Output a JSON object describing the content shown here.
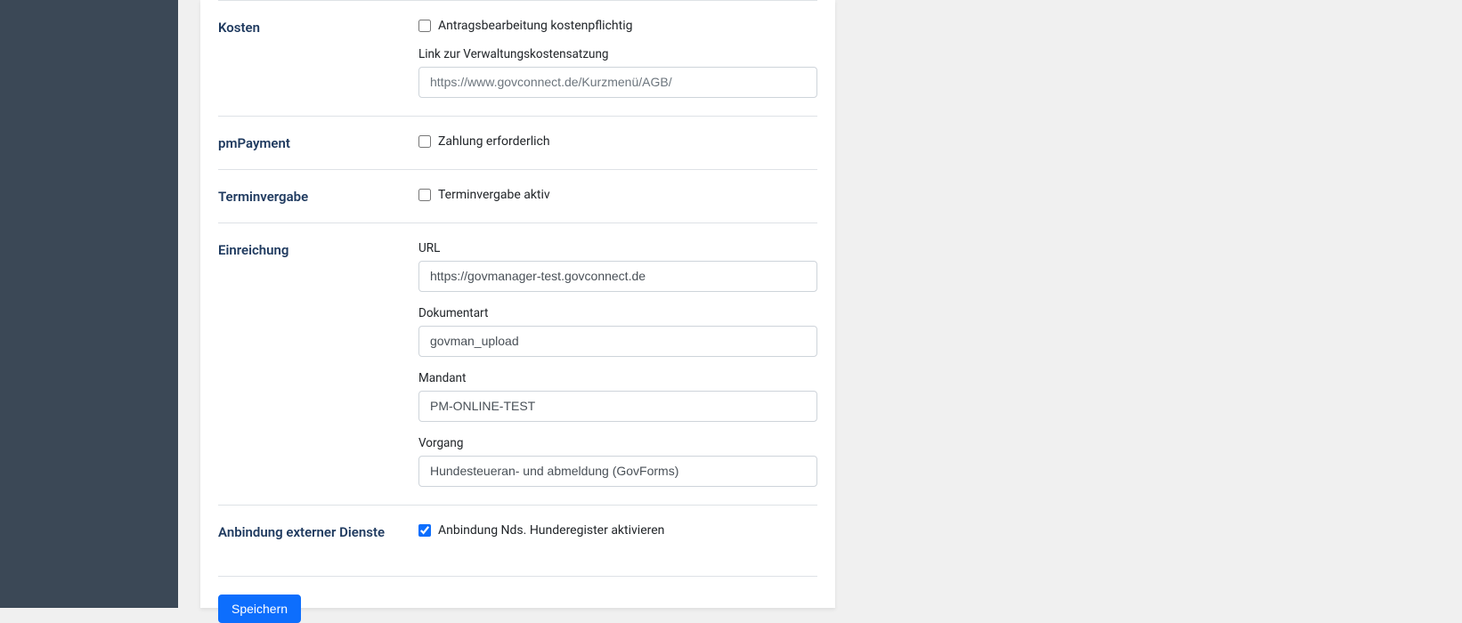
{
  "sections": {
    "kosten": {
      "title": "Kosten",
      "checkbox_label": "Antragsbearbeitung kostenpflichtig",
      "link_label": "Link zur Verwaltungskostensatzung",
      "link_placeholder": "https://www.govconnect.de/Kurzmenü/AGB/"
    },
    "pmpayment": {
      "title": "pmPayment",
      "checkbox_label": "Zahlung erforderlich"
    },
    "terminvergabe": {
      "title": "Terminvergabe",
      "checkbox_label": "Terminvergabe aktiv"
    },
    "einreichung": {
      "title": "Einreichung",
      "url_label": "URL",
      "url_value": "https://govmanager-test.govconnect.de",
      "dokumentart_label": "Dokumentart",
      "dokumentart_value": "govman_upload",
      "mandant_label": "Mandant",
      "mandant_value": "PM-ONLINE-TEST",
      "vorgang_label": "Vorgang",
      "vorgang_value": "Hundesteueran- und abmeldung (GovForms)"
    },
    "anbindung": {
      "title": "Anbindung externer Dienste",
      "checkbox_label": "Anbindung Nds. Hunderegister aktivieren"
    }
  },
  "buttons": {
    "save": "Speichern"
  }
}
